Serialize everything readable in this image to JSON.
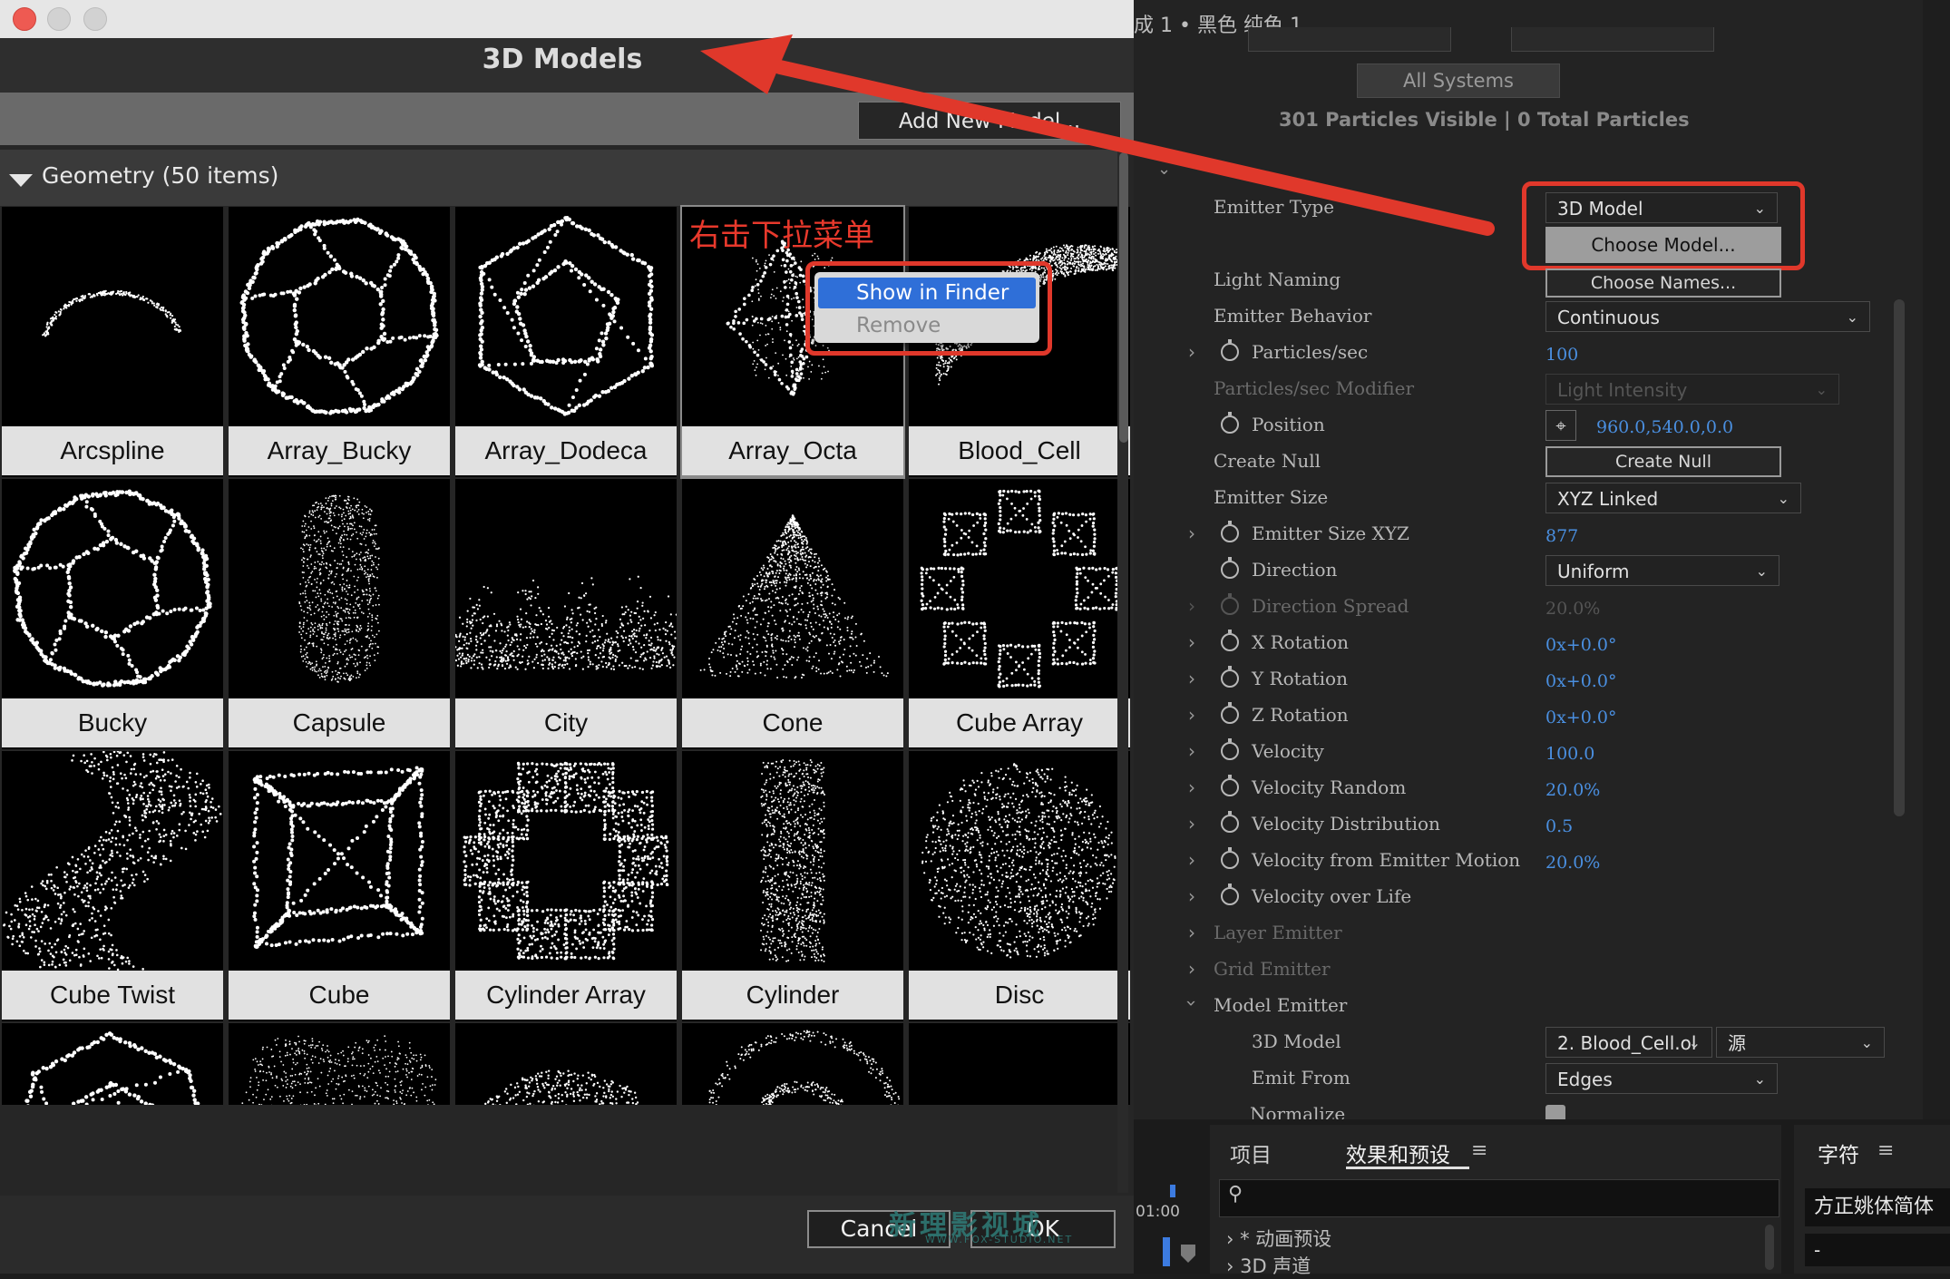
{
  "colors": {
    "accent_blue": "#4a8fe0",
    "annotation_red": "#e0382b",
    "menu_highlight": "#2f6fd8"
  },
  "dialog": {
    "title": "3D Models",
    "add_model_label": "Add New Model...",
    "section_label": "Geometry  (50 items)",
    "cancel_label": "Cancel",
    "ok_label": "OK",
    "selected_model": "Array_Octa",
    "models": [
      {
        "name": "Arcspline",
        "icon": "arc-particles"
      },
      {
        "name": "Array_Bucky",
        "icon": "bucky-array"
      },
      {
        "name": "Array_Dodeca",
        "icon": "dodecahedron"
      },
      {
        "name": "Array_Octa",
        "icon": "octahedron"
      },
      {
        "name": "Blood_Cell",
        "icon": "blood-cell"
      },
      {
        "name": "Bucky",
        "icon": "buckyball"
      },
      {
        "name": "Capsule",
        "icon": "capsule"
      },
      {
        "name": "City",
        "icon": "city"
      },
      {
        "name": "Cone",
        "icon": "cone"
      },
      {
        "name": "Cube Array",
        "icon": "cube-ring"
      },
      {
        "name": "Cube Twist",
        "icon": "cube-twist"
      },
      {
        "name": "Cube",
        "icon": "cube"
      },
      {
        "name": "Cylinder Array",
        "icon": "cylinder-ring"
      },
      {
        "name": "Cylinder",
        "icon": "cylinder"
      },
      {
        "name": "Disc",
        "icon": "disc"
      },
      {
        "name": "",
        "icon": "icosahedron"
      },
      {
        "name": "",
        "icon": "heart"
      },
      {
        "name": "",
        "icon": "cloud"
      },
      {
        "name": "",
        "icon": "spiral"
      },
      {
        "name": "",
        "icon": "dome"
      }
    ]
  },
  "context_menu": {
    "items": [
      {
        "label": "Show in Finder",
        "highlighted": true
      },
      {
        "label": "Remove",
        "enabled": false
      }
    ]
  },
  "annotation": {
    "text": "右击下拉菜单"
  },
  "watermark": {
    "text": "新理影视城",
    "sub": "WWW.FOX-STUDIO.NET"
  },
  "effect_panel": {
    "title": "成 1 • 黑色 纯色 1",
    "all_systems": "All  Systems",
    "particles_status": "301 Particles Visible  |  0 Total Particles",
    "rows": [
      {
        "label": "Emitter Type",
        "control": "dropdown",
        "value": "3D Model"
      },
      {
        "label": "",
        "control": "button",
        "value": "Choose Model..."
      },
      {
        "label": "Light Naming",
        "control": "button",
        "value": "Choose Names..."
      },
      {
        "label": "Emitter Behavior",
        "control": "dropdown",
        "value": "Continuous"
      },
      {
        "label": "Particles/sec",
        "control": "value",
        "value": "100"
      },
      {
        "label": "Particles/sec Modifier",
        "control": "dropdown",
        "value": "Light Intensity"
      },
      {
        "label": "Position",
        "control": "value",
        "value": "960.0,540.0,0.0"
      },
      {
        "label": "Create Null",
        "control": "button",
        "value": "Create Null"
      },
      {
        "label": "Emitter Size",
        "control": "dropdown",
        "value": "XYZ Linked"
      },
      {
        "label": "Emitter Size XYZ",
        "control": "value",
        "value": "877"
      },
      {
        "label": "Direction",
        "control": "dropdown",
        "value": "Uniform"
      },
      {
        "label": "Direction Spread",
        "control": "value",
        "value": "20.0%"
      },
      {
        "label": "X Rotation",
        "control": "value",
        "value": "0x+0.0°"
      },
      {
        "label": "Y Rotation",
        "control": "value",
        "value": "0x+0.0°"
      },
      {
        "label": "Z Rotation",
        "control": "value",
        "value": "0x+0.0°"
      },
      {
        "label": "Velocity",
        "control": "value",
        "value": "100.0"
      },
      {
        "label": "Velocity Random",
        "control": "value",
        "value": "20.0%"
      },
      {
        "label": "Velocity Distribution",
        "control": "value",
        "value": "0.5"
      },
      {
        "label": "Velocity from Emitter Motion",
        "control": "value",
        "value": "20.0%"
      },
      {
        "label": "Velocity over Life",
        "control": "none",
        "value": ""
      },
      {
        "label": "Layer Emitter",
        "control": "none",
        "value": ""
      },
      {
        "label": "Grid Emitter",
        "control": "none",
        "value": ""
      },
      {
        "label": "Model Emitter",
        "control": "none",
        "value": ""
      },
      {
        "label": "3D Model",
        "control": "dropdown",
        "value": "2. Blood_Cell.ol"
      },
      {
        "label": "Emit From",
        "control": "dropdown",
        "value": "Edges"
      },
      {
        "label": "Normalize",
        "control": "checkbox",
        "value": ""
      }
    ],
    "source_dropdown": "源"
  },
  "bottom": {
    "tab_project": "项目",
    "tab_effects": "效果和预设",
    "tab_char": "字符",
    "tree": [
      "* 动画预设",
      "3D 声道"
    ],
    "font": "方正姚体简体",
    "font_size": "-",
    "timecode": "01:00"
  }
}
